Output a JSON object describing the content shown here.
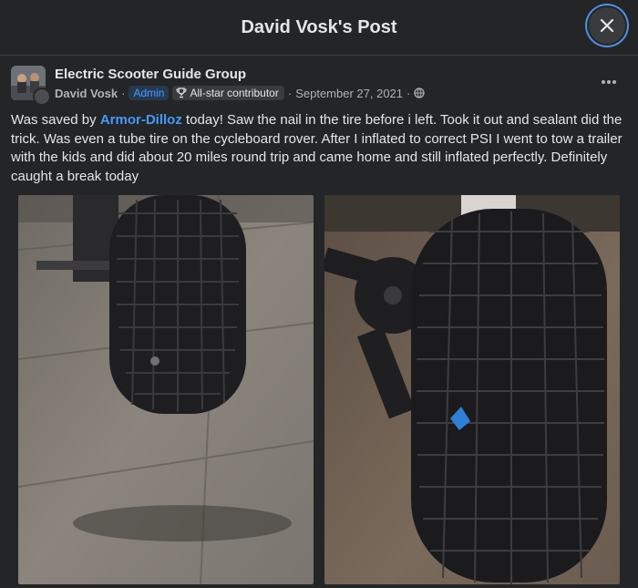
{
  "header": {
    "title": "David Vosk's Post"
  },
  "post": {
    "group": "Electric Scooter Guide Group",
    "author": "David Vosk",
    "sep": "·",
    "admin_badge": "Admin",
    "allstar_badge": "All-star contributor",
    "date": "September 27, 2021",
    "text_prefix": "Was saved by ",
    "mention": "Armor-Dilloz",
    "text_suffix": " today! Saw the nail in the tire before i left. Took it out and sealant did the trick. Was even a tube tire on the cycleboard rover. After I inflated to correct PSI I went to tow a trailer with the kids and did about 20 miles round trip and came home and still inflated perfectly. Definitely caught a break today"
  },
  "icons": {
    "close": "close-icon",
    "more": "more-options-icon",
    "trophy": "trophy-icon",
    "globe": "globe-icon"
  },
  "colors": {
    "background": "#242526",
    "link": "#4599ff",
    "focus_ring": "#4e8fe8"
  }
}
